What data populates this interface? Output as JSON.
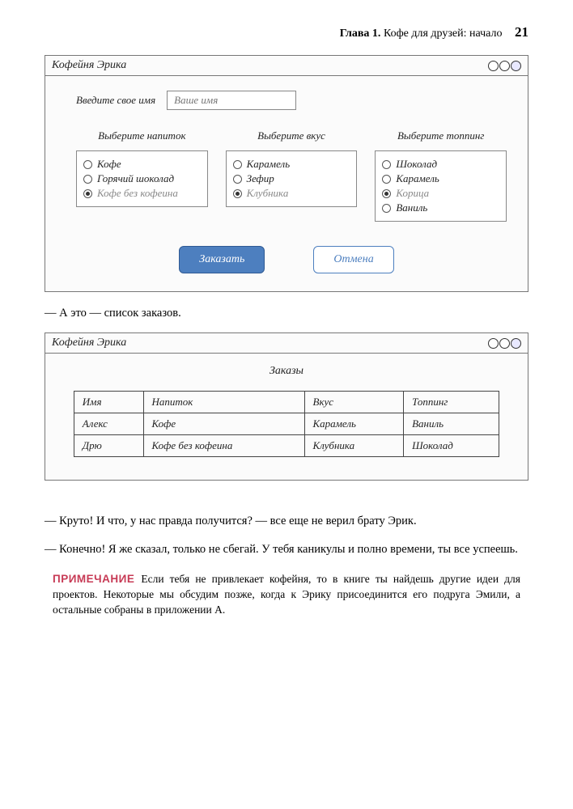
{
  "header": {
    "chapter_label": "Глава 1.",
    "chapter_title": "Кофе для друзей: начало",
    "page_number": "21"
  },
  "mockup1": {
    "title": "Кофейня Эрика",
    "name_prompt": "Введите свое имя",
    "name_placeholder": "Ваше имя",
    "columns": {
      "drink": {
        "label": "Выберите напиток",
        "options": [
          "Кофе",
          "Горячий шоколад",
          "Кофе без кофеина"
        ],
        "selected": 2
      },
      "flavor": {
        "label": "Выберите вкус",
        "options": [
          "Карамель",
          "Зефир",
          "Клубника"
        ],
        "selected": 2
      },
      "topping": {
        "label": "Выберите топпинг",
        "options": [
          "Шоколад",
          "Карамель",
          "Корица",
          "Ваниль"
        ],
        "selected": 2
      }
    },
    "order_button": "Заказать",
    "cancel_button": "Отмена"
  },
  "body_text_1": "— А это — список заказов.",
  "mockup2": {
    "title": "Кофейня Эрика",
    "orders_heading": "Заказы",
    "table_headers": [
      "Имя",
      "Напиток",
      "Вкус",
      "Топпинг"
    ],
    "rows": [
      [
        "Алекс",
        "Кофе",
        "Карамель",
        "Ваниль"
      ],
      [
        "Дрю",
        "Кофе без кофеина",
        "Клубника",
        "Шоколад"
      ]
    ]
  },
  "body_text_2": "— Круто! И что, у нас правда получится? — все еще не верил брату Эрик.",
  "body_text_3": "— Конечно! Я же сказал, только не сбегай. У тебя каникулы и полно времени, ты все успеешь.",
  "note": {
    "label": "ПРИМЕЧАНИЕ",
    "text": "Если тебя не привлекает кофейня, то в книге ты найдешь другие идеи для проектов. Некоторые мы обсудим позже, когда к Эрику присоединится его подруга Эмили, а остальные собраны в приложении А."
  }
}
